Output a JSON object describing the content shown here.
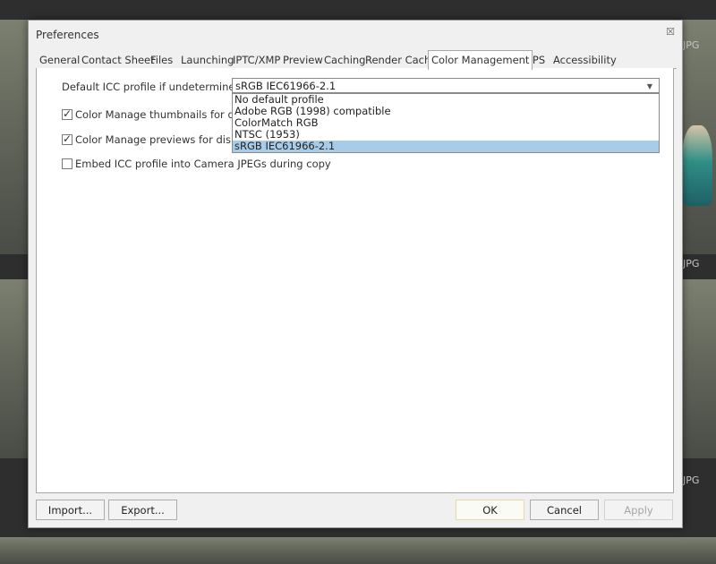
{
  "background": {
    "file_labels": [
      "JPG",
      "JPG",
      "JPG"
    ]
  },
  "dialog": {
    "title": "Preferences",
    "close_icon": "close-icon",
    "tabs": [
      {
        "label": "General"
      },
      {
        "label": "Contact Sheet"
      },
      {
        "label": "Files"
      },
      {
        "label": "Launching"
      },
      {
        "label": "IPTC/XMP"
      },
      {
        "label": "Preview"
      },
      {
        "label": "Caching"
      },
      {
        "label": "Render Cache"
      },
      {
        "label": "Color Management"
      },
      {
        "label": "GPS"
      },
      {
        "label": "Accessibility"
      }
    ],
    "active_tab": "Color Management",
    "default_profile": {
      "label": "Default ICC profile if undetermined:",
      "value": "sRGB IEC61966-2.1",
      "options": [
        "No default profile",
        "Adobe RGB (1998) compatible",
        "ColorMatch RGB",
        "NTSC (1953)",
        "sRGB IEC61966-2.1"
      ]
    },
    "checkboxes": [
      {
        "label": "Color Manage thumbnails for display",
        "checked": true
      },
      {
        "label": "Color Manage previews for display",
        "checked": true
      },
      {
        "label": "Embed ICC profile into Camera JPEGs during copy",
        "checked": false
      }
    ],
    "buttons": {
      "import": "Import...",
      "export": "Export...",
      "ok": "OK",
      "cancel": "Cancel",
      "apply": "Apply"
    }
  }
}
